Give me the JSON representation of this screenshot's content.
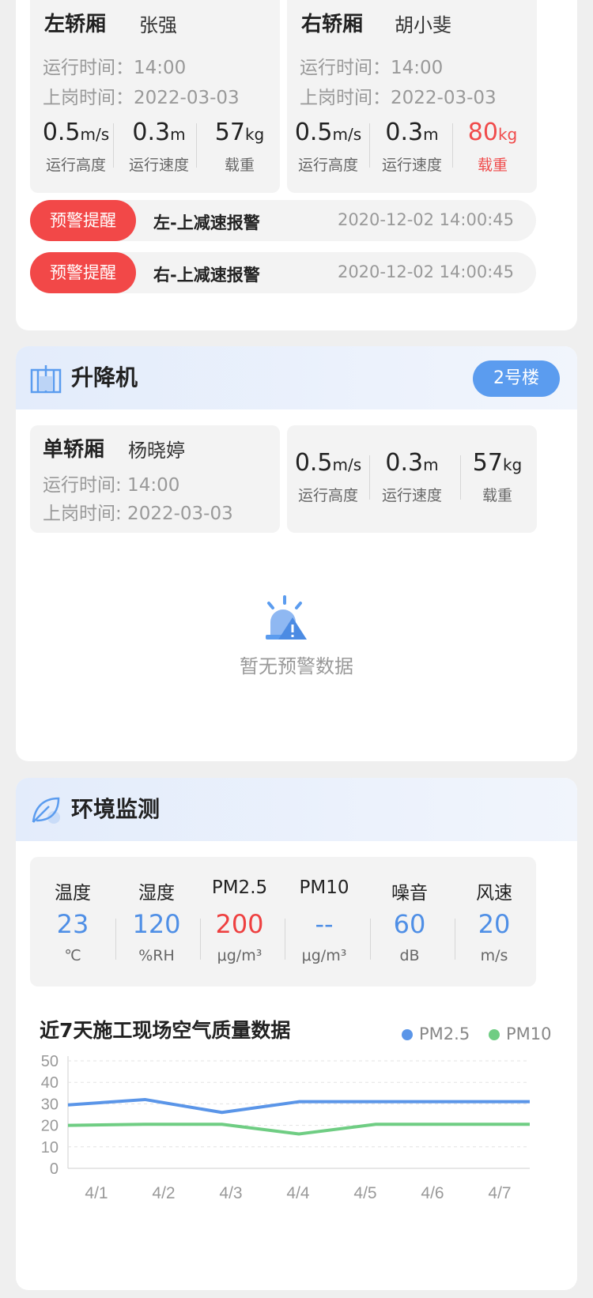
{
  "top_card": {
    "left_cab": {
      "name": "左轿厢",
      "person": "张强",
      "run_time": "运行时间：14:00",
      "duty_time": "上岗时间：2022-03-03",
      "metrics": [
        {
          "value": "0.5",
          "unit": "m/s",
          "label": "运行高度"
        },
        {
          "value": "0.3",
          "unit": "m",
          "label": "运行速度"
        },
        {
          "value": "57",
          "unit": "kg",
          "label": "载重"
        }
      ]
    },
    "right_cab": {
      "name": "右轿厢",
      "person": "胡小斐",
      "run_time": "运行时间：14:00",
      "duty_time": "上岗时间：2022-03-03",
      "metrics": [
        {
          "value": "0.5",
          "unit": "m/s",
          "label": "运行高度"
        },
        {
          "value": "0.3",
          "unit": "m",
          "label": "运行速度"
        },
        {
          "value": "80",
          "unit": "kg",
          "label": "载重",
          "alert": true
        }
      ]
    },
    "alerts": [
      {
        "tag": "预警提醒",
        "text": "左-上减速报警",
        "time": "2020-12-02 14:00:45"
      },
      {
        "tag": "预警提醒",
        "text": "右-上减速报警",
        "time": "2020-12-02 14:00:45"
      }
    ]
  },
  "elevator_card": {
    "title": "升降机",
    "building": "2号楼",
    "cab": {
      "name": "单轿厢",
      "person": "杨晓婷",
      "run_time": "运行时间: 14:00",
      "duty_time": "上岗时间: 2022-03-03"
    },
    "metrics": [
      {
        "value": "0.5",
        "unit": "m/s",
        "label": "运行高度"
      },
      {
        "value": "0.3",
        "unit": "m",
        "label": "运行速度"
      },
      {
        "value": "57",
        "unit": "kg",
        "label": "载重"
      }
    ],
    "empty_text": "暂无预警数据"
  },
  "env_card": {
    "title": "环境监测",
    "items": [
      {
        "label": "温度",
        "value": "23",
        "unit": "℃"
      },
      {
        "label": "湿度",
        "value": "120",
        "unit": "%RH"
      },
      {
        "label": "PM2.5",
        "value": "200",
        "unit": "μg/m³",
        "alert": true
      },
      {
        "label": "PM10",
        "value": "--",
        "unit": "μg/m³"
      },
      {
        "label": "噪音",
        "value": "60",
        "unit": "dB"
      },
      {
        "label": "风速",
        "value": "20",
        "unit": "m/s"
      }
    ],
    "chart_title": "近7天施工现场空气质量数据"
  },
  "colors": {
    "accent": "#5b9cef",
    "alert": "#f24848",
    "pm25": "#5a95e8",
    "pm10": "#6fcd83"
  },
  "chart_data": {
    "type": "line",
    "categories": [
      "4/1",
      "4/2",
      "4/3",
      "4/4",
      "4/5",
      "4/6",
      "4/7"
    ],
    "series": [
      {
        "name": "PM2.5",
        "values": [
          29.5,
          32,
          26,
          31,
          31,
          31,
          31
        ]
      },
      {
        "name": "PM10",
        "values": [
          20,
          20.5,
          20.5,
          16,
          20.5,
          20.5,
          20.5
        ]
      }
    ],
    "yticks": [
      0,
      10,
      20,
      30,
      40,
      50
    ],
    "ylim": [
      0,
      50
    ],
    "grid": true,
    "legend": "top-right"
  }
}
